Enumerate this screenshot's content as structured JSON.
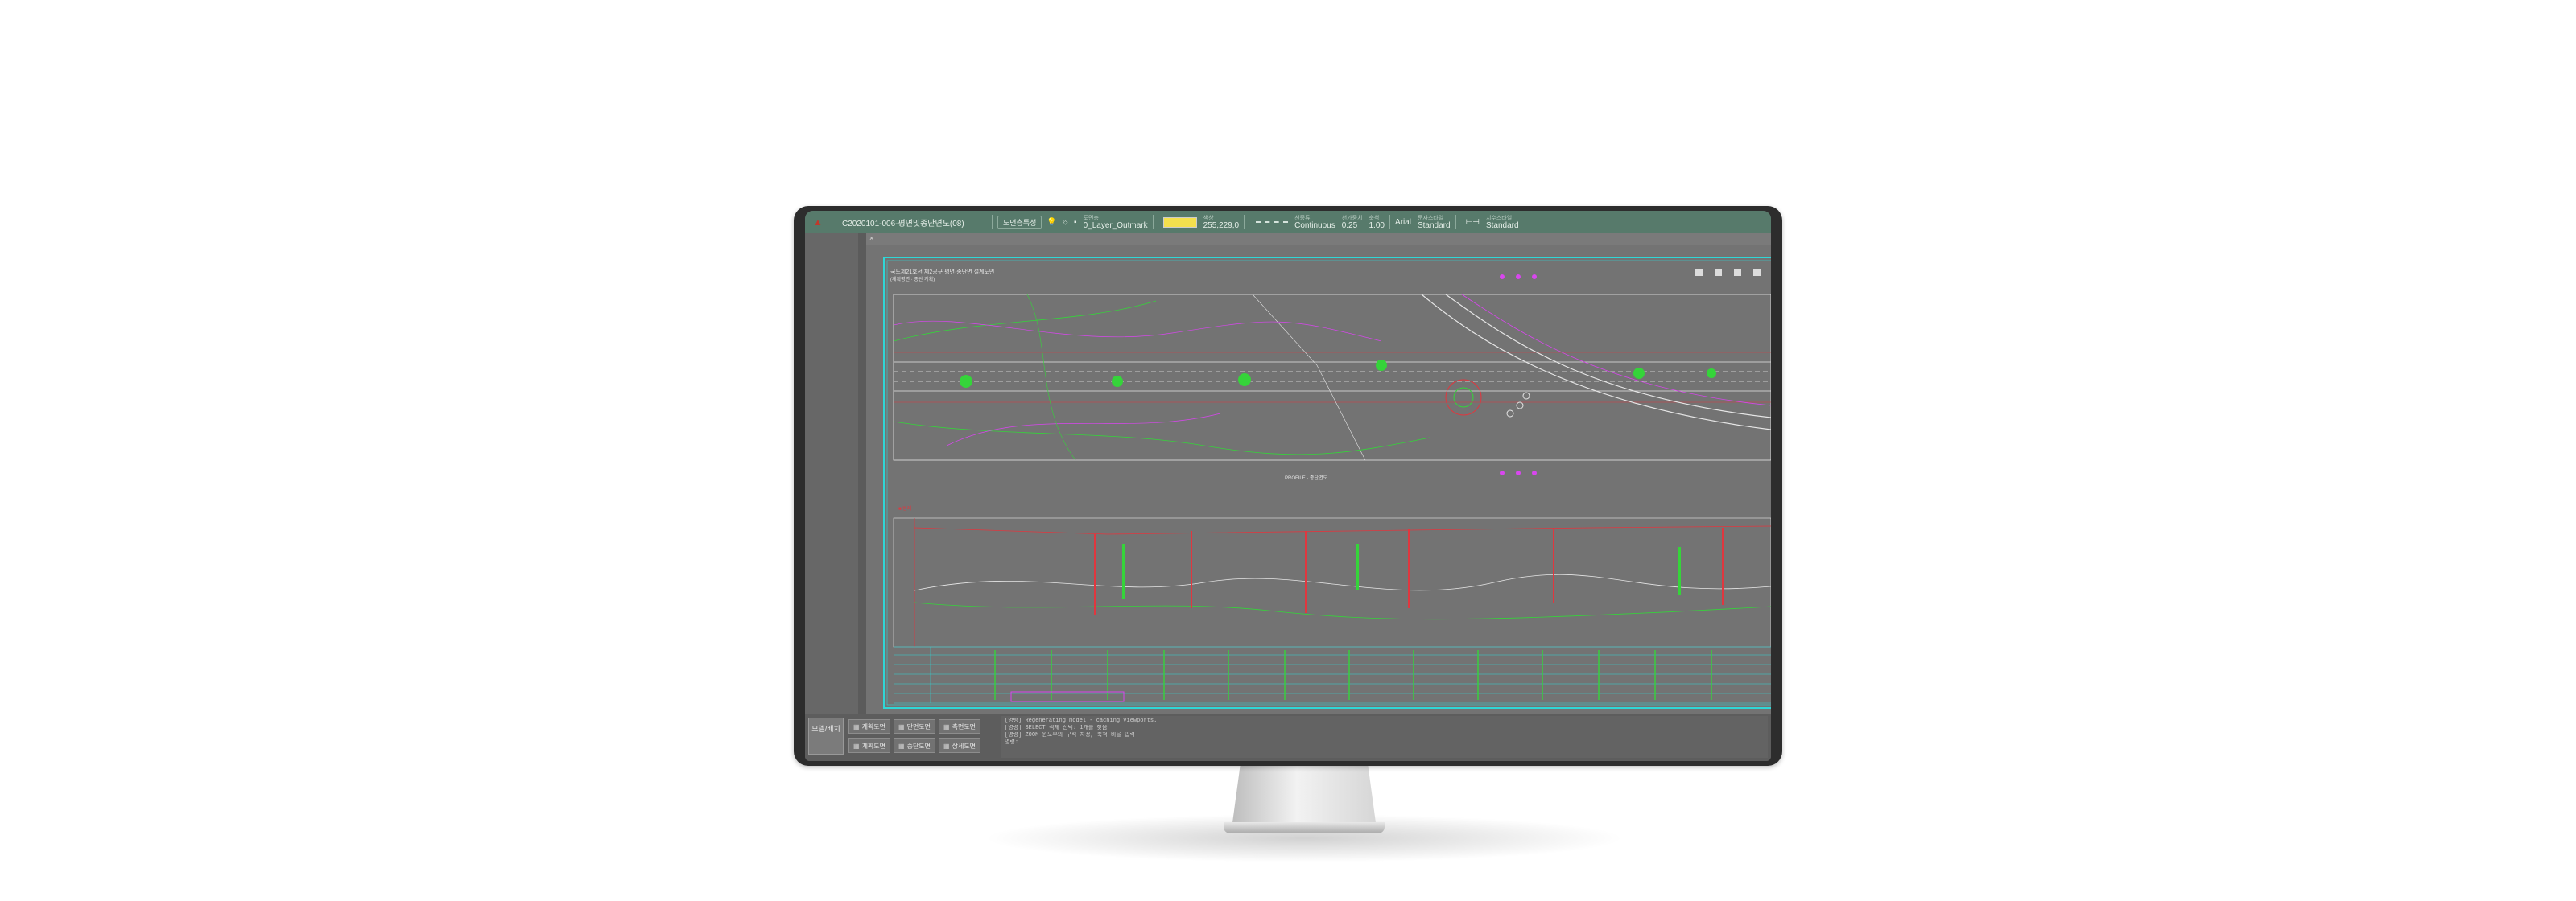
{
  "toolbar": {
    "file_title": "C2020101-006-평면및종단면도(08)",
    "layer_button": "도면층특성",
    "layer_small": "도면층",
    "layer_name": "0_Layer_Outmark",
    "color_small": "색상",
    "color_value": "255,229,0",
    "linetype_small": "선종류",
    "linetype_value": "Continuous",
    "lineweight_small": "선가중치",
    "lineweight_value": "0.25",
    "ltscale_small": "축척",
    "ltscale_value": "1.00",
    "font_label": "Arial",
    "text_style_small": "문자스타일",
    "text_style_value": "Standard",
    "dim_style_small": "치수스타일",
    "dim_style_value": "Standard"
  },
  "drawing": {
    "title_line1": "국도제21호선 제2공구 평면·종단면 설계도면",
    "title_line2": "(계획평면 · 종단 계획)",
    "profile_label": "PROFILE · 종단면도",
    "legend_label": "■ 범례",
    "colors": {
      "border": "#2fd6d6",
      "green": "#35d43a",
      "red": "#e0373f",
      "magenta": "#d946ef",
      "white": "#e6e6e6"
    }
  },
  "bottom": {
    "panel_label": "모델/배치",
    "row1": [
      "계획도면",
      "단면도면",
      "측면도면"
    ],
    "row2": [
      "계획도면",
      "종단도면",
      "상세도면"
    ],
    "command_lines": [
      "[명령] Regenerating model - caching viewports.",
      "[명령] SELECT 객체 선택: 1개를 찾음",
      "[명령] ZOOM 윈도우의 구석 지정, 축척 비율 입력",
      "명령:"
    ]
  }
}
